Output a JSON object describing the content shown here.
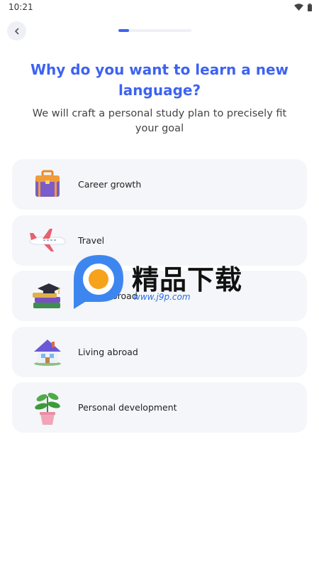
{
  "status_bar": {
    "time": "10:21",
    "icons": [
      "wifi-icon",
      "battery-icon"
    ]
  },
  "header": {
    "back_icon": "chevron-left-icon",
    "progress": 0.15
  },
  "title": "Why do you want to learn a new language?",
  "subtitle": "We will craft a personal study plan to precisely fit your goal",
  "options": [
    {
      "label": "Career growth",
      "icon": "briefcase-icon"
    },
    {
      "label": "Travel",
      "icon": "airplane-icon"
    },
    {
      "label": "Study abroad",
      "icon": "graduation-books-icon"
    },
    {
      "label": "Living abroad",
      "icon": "house-icon"
    },
    {
      "label": "Personal development",
      "icon": "plant-icon"
    }
  ],
  "watermark": {
    "text": "精品下载",
    "url": "www.j9p.com"
  },
  "colors": {
    "accent": "#3d63f2",
    "card": "#f4f6f9"
  }
}
